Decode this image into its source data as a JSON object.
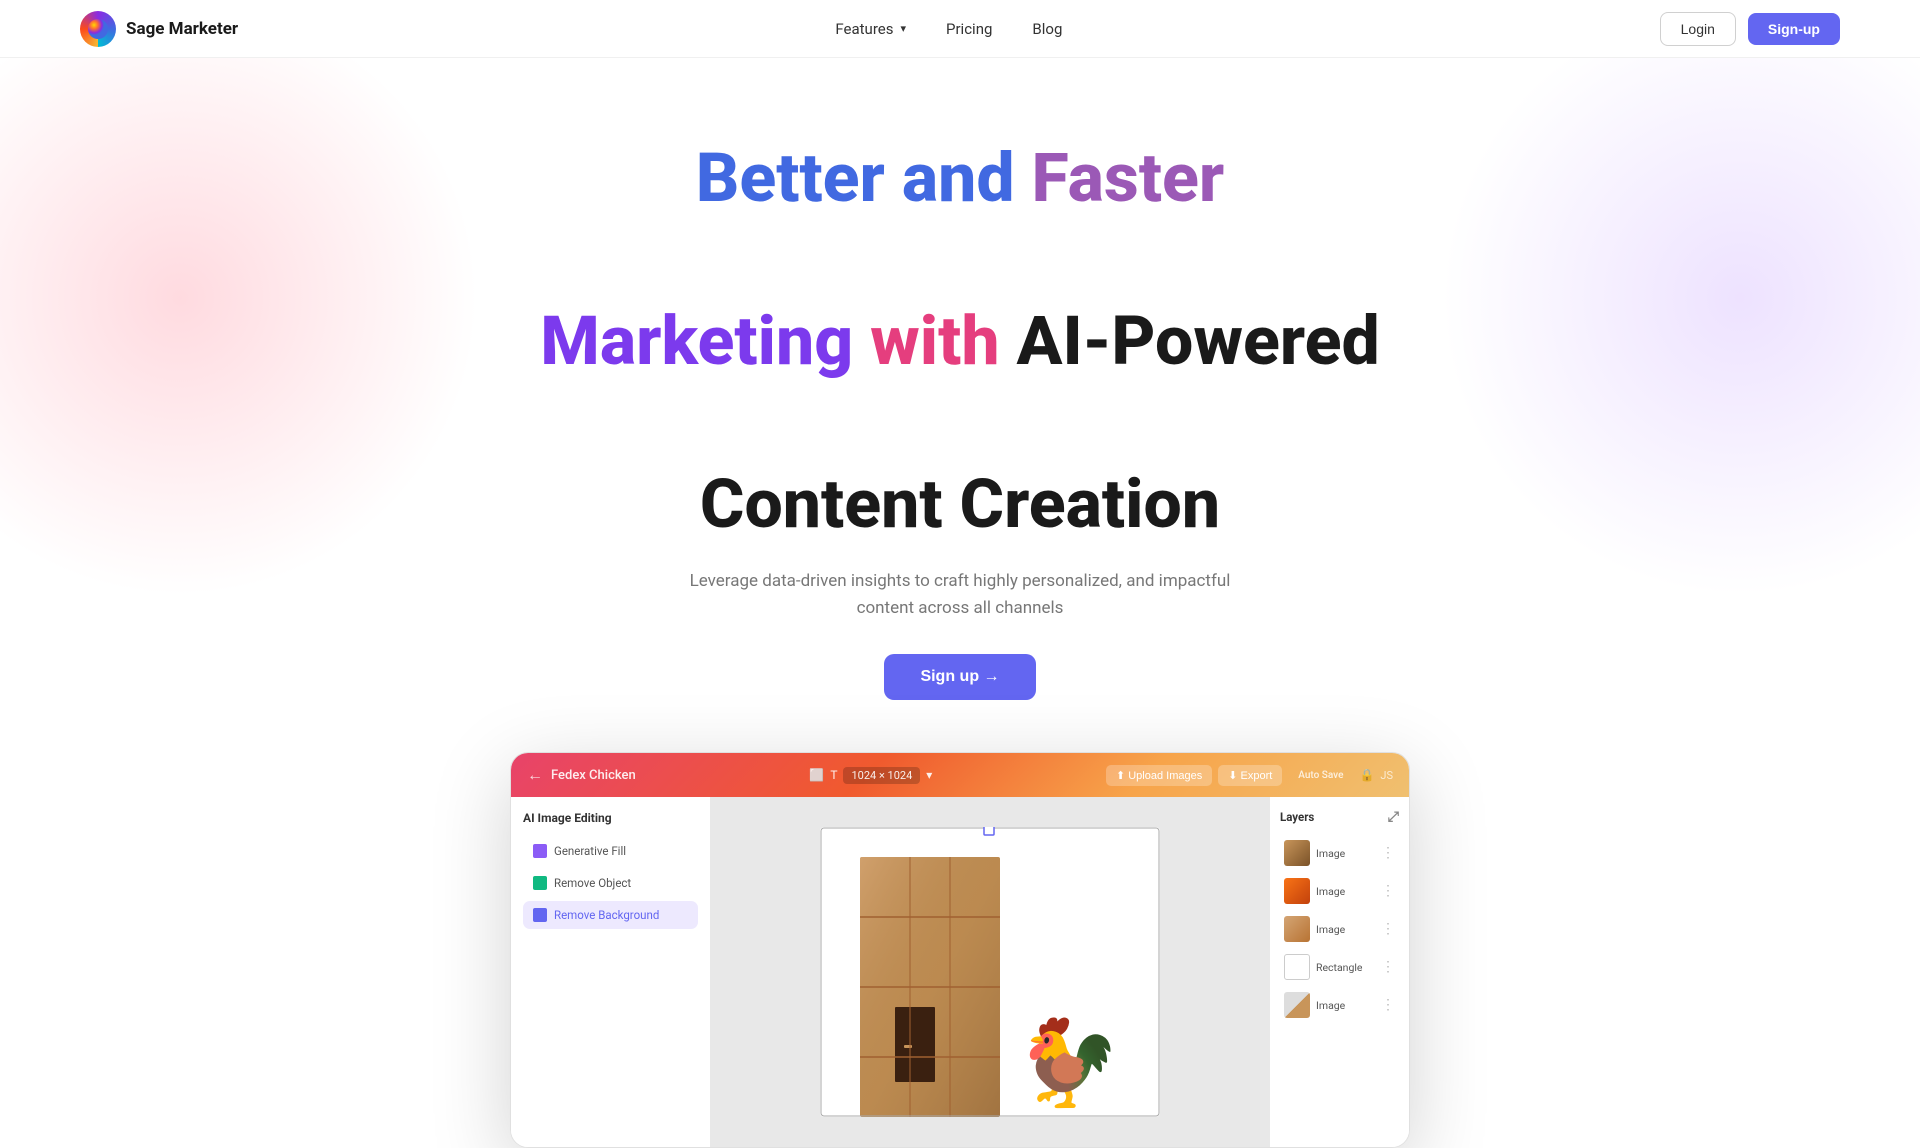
{
  "brand": {
    "name": "Sage Marketer",
    "logo_emoji": "🌐"
  },
  "nav": {
    "features_label": "Features",
    "pricing_label": "Pricing",
    "blog_label": "Blog",
    "login_label": "Login",
    "signup_label": "Sign-up"
  },
  "hero": {
    "title_line1_word1": "Better",
    "title_line1_word2": "and",
    "title_line1_word3": "Faster",
    "title_line2_word1": "Marketing",
    "title_line2_word2": "with",
    "title_line2_word3": "AI-Powered",
    "title_line3": "Content Creation",
    "subtitle": "Leverage data-driven insights to craft highly personalized, and impactful content across all channels",
    "cta_label": "Sign up →"
  },
  "demo": {
    "titlebar": {
      "back_label": "Fedex Chicken",
      "dimensions": "1024 × 1024",
      "upload_label": "⬆ Upload Images",
      "export_label": "⬇ Export",
      "autosave_label": "Auto Save"
    },
    "left_panel": {
      "title": "AI Image Editing",
      "items": [
        {
          "label": "Generative Fill",
          "color": "purple"
        },
        {
          "label": "Remove Object",
          "color": "green"
        },
        {
          "label": "Remove Background",
          "color": "indigo",
          "active": true
        }
      ]
    },
    "right_panel": {
      "title": "Layers",
      "items": [
        {
          "label": "Image",
          "type": "brown"
        },
        {
          "label": "Image",
          "type": "orange"
        },
        {
          "label": "Image",
          "type": "tan"
        },
        {
          "label": "Rectangle",
          "type": "outline"
        },
        {
          "label": "Image",
          "type": "mix"
        }
      ]
    }
  },
  "colors": {
    "accent": "#6366f1",
    "word_better": "#4169e1",
    "word_faster": "#9b59b6",
    "word_marketing": "#7c3aed",
    "word_with": "#e53e7e"
  }
}
